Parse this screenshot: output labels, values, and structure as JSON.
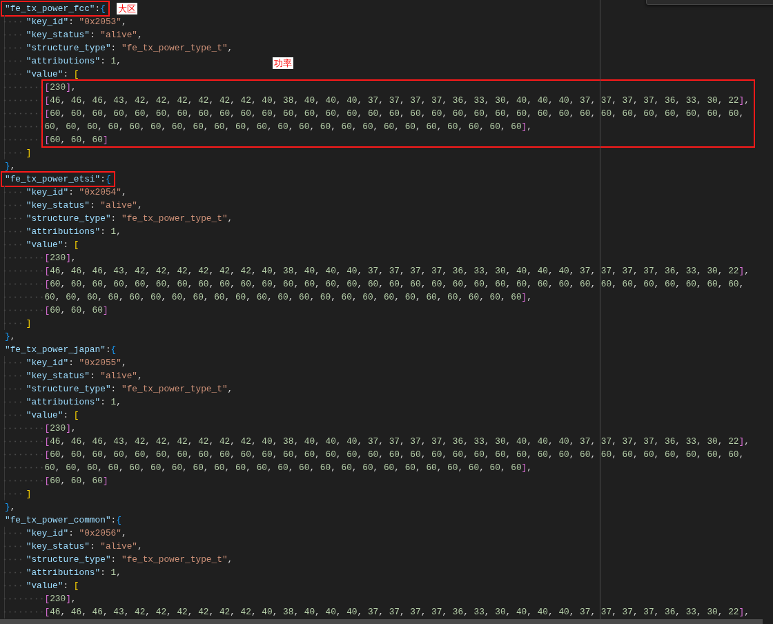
{
  "blocks": [
    {
      "header": {
        "text": "\"fe_tx_power_fcc\":{",
        "highlighted": true,
        "annotation": "大区"
      },
      "fields": [
        "\"key_id\": \"0x2053\",",
        "\"key_status\": \"alive\",",
        "\"structure_type\": \"fe_tx_power_type_t\",",
        "\"attributions\": 1,"
      ],
      "value_open": "\"value\": [",
      "rows": {
        "highlighted": true,
        "annotation": "功率",
        "lines": [
          "[230],",
          "[46, 46, 46, 43, 42, 42, 42, 42, 42, 42, 40, 38, 40, 40, 40, 37, 37, 37, 37, 36, 33, 30, 40, 40, 40, 37, 37, 37, 37, 36, 33, 30, 22],",
          "[60, 60, 60, 60, 60, 60, 60, 60, 60, 60, 60, 60, 60, 60, 60, 60, 60, 60, 60, 60, 60, 60, 60, 60, 60, 60, 60, 60, 60, 60, 60, 60, 60,",
          "60, 60, 60, 60, 60, 60, 60, 60, 60, 60, 60, 60, 60, 60, 60, 60, 60, 60, 60, 60, 60, 60, 60],",
          "[60, 60, 60]"
        ]
      },
      "value_close": "]",
      "close": "},"
    },
    {
      "header": {
        "text": "\"fe_tx_power_etsi\":{",
        "highlighted": true
      },
      "fields": [
        "\"key_id\": \"0x2054\",",
        "\"key_status\": \"alive\",",
        "\"structure_type\": \"fe_tx_power_type_t\",",
        "\"attributions\": 1,"
      ],
      "value_open": "\"value\": [",
      "rows": {
        "highlighted": false,
        "lines": [
          "[230],",
          "[46, 46, 46, 43, 42, 42, 42, 42, 42, 42, 40, 38, 40, 40, 40, 37, 37, 37, 37, 36, 33, 30, 40, 40, 40, 37, 37, 37, 37, 36, 33, 30, 22],",
          "[60, 60, 60, 60, 60, 60, 60, 60, 60, 60, 60, 60, 60, 60, 60, 60, 60, 60, 60, 60, 60, 60, 60, 60, 60, 60, 60, 60, 60, 60, 60, 60, 60,",
          "60, 60, 60, 60, 60, 60, 60, 60, 60, 60, 60, 60, 60, 60, 60, 60, 60, 60, 60, 60, 60, 60, 60],",
          "[60, 60, 60]"
        ]
      },
      "value_close": "]",
      "close": "},"
    },
    {
      "header": {
        "text": "\"fe_tx_power_japan\":{",
        "highlighted": false
      },
      "fields": [
        "\"key_id\": \"0x2055\",",
        "\"key_status\": \"alive\",",
        "\"structure_type\": \"fe_tx_power_type_t\",",
        "\"attributions\": 1,"
      ],
      "value_open": "\"value\": [",
      "rows": {
        "highlighted": false,
        "lines": [
          "[230],",
          "[46, 46, 46, 43, 42, 42, 42, 42, 42, 42, 40, 38, 40, 40, 40, 37, 37, 37, 37, 36, 33, 30, 40, 40, 40, 37, 37, 37, 37, 36, 33, 30, 22],",
          "[60, 60, 60, 60, 60, 60, 60, 60, 60, 60, 60, 60, 60, 60, 60, 60, 60, 60, 60, 60, 60, 60, 60, 60, 60, 60, 60, 60, 60, 60, 60, 60, 60,",
          "60, 60, 60, 60, 60, 60, 60, 60, 60, 60, 60, 60, 60, 60, 60, 60, 60, 60, 60, 60, 60, 60, 60],",
          "[60, 60, 60]"
        ]
      },
      "value_close": "]",
      "close": "},"
    },
    {
      "header": {
        "text": "\"fe_tx_power_common\":{",
        "highlighted": false
      },
      "fields": [
        "\"key_id\": \"0x2056\",",
        "\"key_status\": \"alive\",",
        "\"structure_type\": \"fe_tx_power_type_t\",",
        "\"attributions\": 1,"
      ],
      "value_open": "\"value\": [",
      "rows": {
        "highlighted": false,
        "lines": [
          "[230],",
          "[46, 46, 46, 43, 42, 42, 42, 42, 42, 42, 40, 38, 40, 40, 40, 37, 37, 37, 37, 36, 33, 30, 40, 40, 40, 37, 37, 37, 37, 36, 33, 30, 22],"
        ]
      }
    }
  ]
}
